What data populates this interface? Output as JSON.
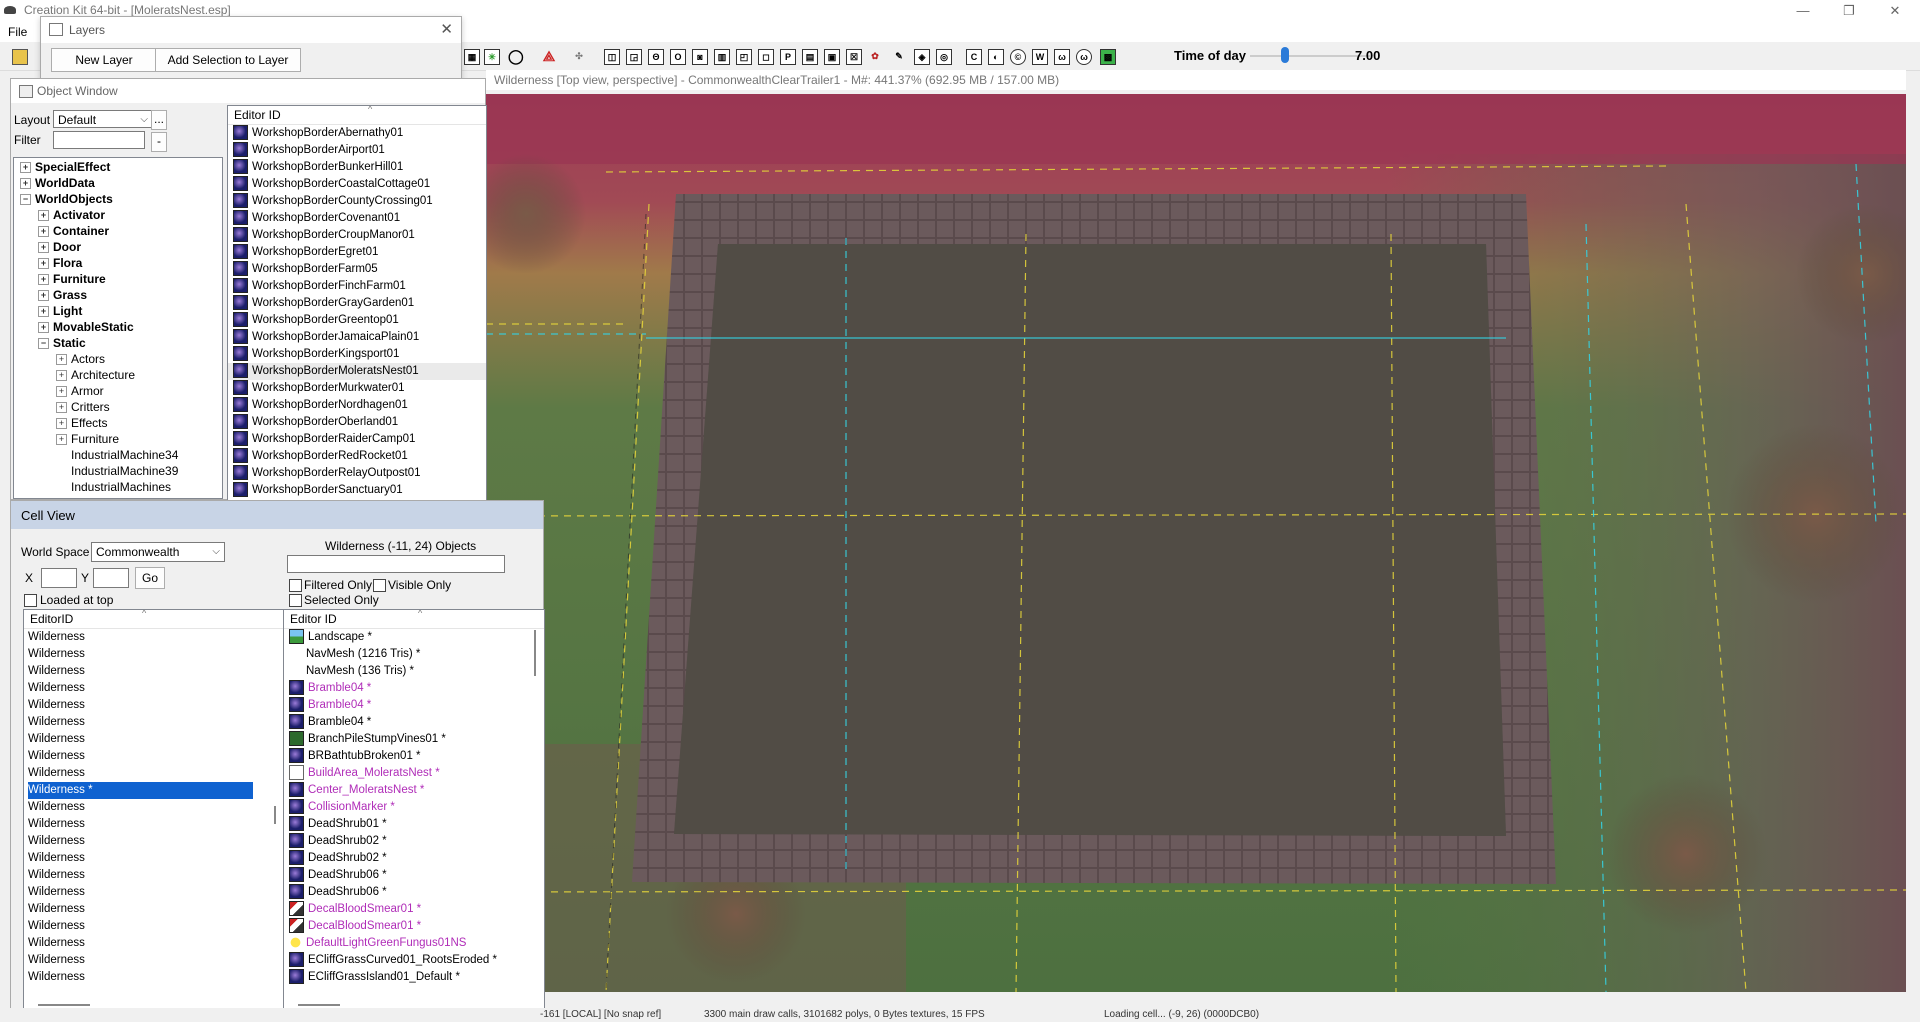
{
  "app": {
    "title": "Creation Kit 64-bit - [MoleratsNest.esp]",
    "window_buttons": [
      "—",
      "❐",
      "✕"
    ]
  },
  "menu": {
    "file": "File"
  },
  "toolbar": {
    "time_of_day_label": "Time of day",
    "time_of_day_value": "7.00",
    "time_of_day_level": 0.29
  },
  "layers": {
    "title": "Layers",
    "new_layer": "New Layer",
    "add_selection": "Add Selection to Layer",
    "close": "✕"
  },
  "object_window": {
    "title": "Object Window",
    "layout_label": "Layout",
    "layout_value": "Default",
    "ellipsis": "...",
    "filter_label": "Filter",
    "filter_value": "",
    "minus": "-",
    "column": "Editor ID",
    "tree": [
      {
        "label": "SpecialEffect",
        "level": 0,
        "bold": true,
        "pm": "+"
      },
      {
        "label": "WorldData",
        "level": 0,
        "bold": true,
        "pm": "+"
      },
      {
        "label": "WorldObjects",
        "level": 0,
        "bold": true,
        "pm": "−"
      },
      {
        "label": "Activator",
        "level": 1,
        "bold": true,
        "pm": "+"
      },
      {
        "label": "Container",
        "level": 1,
        "bold": true,
        "pm": "+"
      },
      {
        "label": "Door",
        "level": 1,
        "bold": true,
        "pm": "+"
      },
      {
        "label": "Flora",
        "level": 1,
        "bold": true,
        "pm": "+"
      },
      {
        "label": "Furniture",
        "level": 1,
        "bold": true,
        "pm": "+"
      },
      {
        "label": "Grass",
        "level": 1,
        "bold": true,
        "pm": "+"
      },
      {
        "label": "Light",
        "level": 1,
        "bold": true,
        "pm": "+"
      },
      {
        "label": "MovableStatic",
        "level": 1,
        "bold": true,
        "pm": "+"
      },
      {
        "label": "Static",
        "level": 1,
        "bold": true,
        "pm": "−"
      },
      {
        "label": "Actors",
        "level": 2,
        "bold": false,
        "pm": "+"
      },
      {
        "label": "Architecture",
        "level": 2,
        "bold": false,
        "pm": "+"
      },
      {
        "label": "Armor",
        "level": 2,
        "bold": false,
        "pm": "+"
      },
      {
        "label": "Critters",
        "level": 2,
        "bold": false,
        "pm": "+"
      },
      {
        "label": "Effects",
        "level": 2,
        "bold": false,
        "pm": "+"
      },
      {
        "label": "Furniture",
        "level": 2,
        "bold": false,
        "pm": "+"
      },
      {
        "label": "IndustrialMachine34",
        "level": 2,
        "bold": false,
        "pm": ""
      },
      {
        "label": "IndustrialMachine39",
        "level": 2,
        "bold": false,
        "pm": ""
      },
      {
        "label": "IndustrialMachines",
        "level": 2,
        "bold": false,
        "pm": ""
      }
    ],
    "objects": [
      "WorkshopBorderAbernathy01",
      "WorkshopBorderAirport01",
      "WorkshopBorderBunkerHill01",
      "WorkshopBorderCoastalCottage01",
      "WorkshopBorderCountyCrossing01",
      "WorkshopBorderCovenant01",
      "WorkshopBorderCroupManor01",
      "WorkshopBorderEgret01",
      "WorkshopBorderFarm05",
      "WorkshopBorderFinchFarm01",
      "WorkshopBorderGrayGarden01",
      "WorkshopBorderGreentop01",
      "WorkshopBorderJamaicaPlain01",
      "WorkshopBorderKingsport01",
      "WorkshopBorderMoleratsNest01",
      "WorkshopBorderMurkwater01",
      "WorkshopBorderNordhagen01",
      "WorkshopBorderOberland01",
      "WorkshopBorderRaiderCamp01",
      "WorkshopBorderRedRocket01",
      "WorkshopBorderRelayOutpost01",
      "WorkshopBorderSanctuary01"
    ],
    "highlighted_object": "WorkshopBorderMoleratsNest01"
  },
  "render": {
    "title": "Wilderness [Top view, perspective] - CommonwealthClearTrailer1 - M#: 441.37% (692.95 MB / 157.00 MB)"
  },
  "cell_view": {
    "title": "Cell View",
    "worldspace_label": "World Space",
    "worldspace_value": "Commonwealth",
    "x_label": "X",
    "y_label": "Y",
    "go": "Go",
    "loaded_at_top": "Loaded at top",
    "objects_header": "Wilderness (-11, 24) Objects",
    "filtered_only": "Filtered Only",
    "visible_only": "Visible Only",
    "selected_only": "Selected Only",
    "cells_column": "EditorID",
    "objects_column": "Editor ID",
    "cells": [
      "Wilderness",
      "Wilderness",
      "Wilderness",
      "Wilderness",
      "Wilderness",
      "Wilderness",
      "Wilderness",
      "Wilderness",
      "Wilderness",
      "Wilderness *",
      "Wilderness",
      "Wilderness",
      "Wilderness",
      "Wilderness",
      "Wilderness",
      "Wilderness",
      "Wilderness",
      "Wilderness",
      "Wilderness",
      "Wilderness",
      "Wilderness"
    ],
    "selected_cell_index": 9,
    "objects": [
      {
        "label": "Landscape *",
        "icon": "landscape",
        "purple": false
      },
      {
        "label": "NavMesh  (1216 Tris)  *",
        "icon": "none",
        "purple": false
      },
      {
        "label": "NavMesh  (136 Tris)  *",
        "icon": "none",
        "purple": false
      },
      {
        "label": "Bramble04 *",
        "icon": "object",
        "purple": true
      },
      {
        "label": "Bramble04 *",
        "icon": "object",
        "purple": true
      },
      {
        "label": "Bramble04 *",
        "icon": "object",
        "purple": false
      },
      {
        "label": "BranchPileStumpVines01 *",
        "icon": "scol",
        "purple": false
      },
      {
        "label": "BRBathtubBroken01 *",
        "icon": "object",
        "purple": false
      },
      {
        "label": "BuildArea_MoleratsNest *",
        "icon": "activator",
        "purple": true
      },
      {
        "label": "Center_MoleratsNest *",
        "icon": "object",
        "purple": true
      },
      {
        "label": "CollisionMarker *",
        "icon": "object",
        "purple": true
      },
      {
        "label": "DeadShrub01 *",
        "icon": "object",
        "purple": false
      },
      {
        "label": "DeadShrub02 *",
        "icon": "object",
        "purple": false
      },
      {
        "label": "DeadShrub02 *",
        "icon": "object",
        "purple": false
      },
      {
        "label": "DeadShrub06 *",
        "icon": "object",
        "purple": false
      },
      {
        "label": "DeadShrub06 *",
        "icon": "object",
        "purple": false
      },
      {
        "label": "DecalBloodSmear01 *",
        "icon": "decal",
        "purple": true
      },
      {
        "label": "DecalBloodSmear01 *",
        "icon": "decal",
        "purple": true
      },
      {
        "label": "DefaultLightGreenFungus01NS",
        "icon": "light",
        "purple": true
      },
      {
        "label": "ECliffGrassCurved01_RootsEroded *",
        "icon": "object",
        "purple": false
      },
      {
        "label": "ECliffGrassIsland01_Default *",
        "icon": "object",
        "purple": false
      }
    ]
  },
  "status": {
    "s1": "-161 [LOCAL] [No snap ref]",
    "s2": "3300 main draw calls, 3101682 polys, 0 Bytes textures, 15 FPS",
    "s3": "Loading cell... (-9, 26) (0000DCB0)"
  }
}
